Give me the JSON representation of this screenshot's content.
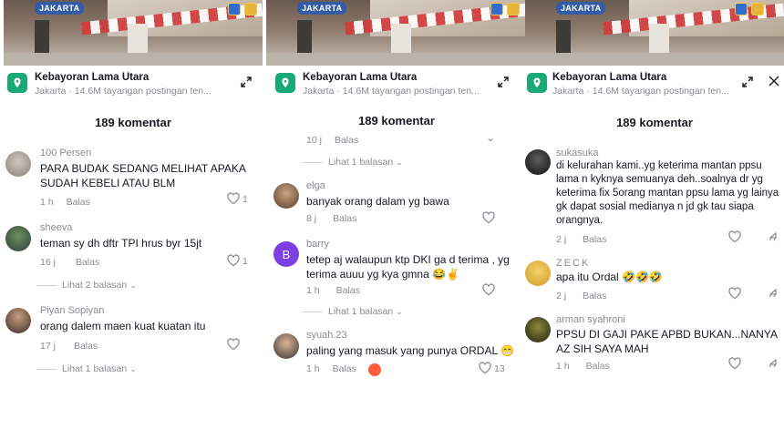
{
  "location": {
    "title": "Kebayoran Lama Utara",
    "subtitle": "Jakarta · 14.6M tayangan postingan ten...",
    "badge": "JAKARTA"
  },
  "comment_count": "189 komentar",
  "labels": {
    "reply": "Balas"
  },
  "panel1": {
    "comments": [
      {
        "user": "100 Persen",
        "text": "PARA BUDAK SEDANG MELIHAT APAKA SUDAH KEBELI ATAU BLM",
        "time": "1 h",
        "likes": "1"
      },
      {
        "user": "sheeva",
        "text": "teman sy dh dftr TPI hrus byr 15jt",
        "time": "16 j",
        "likes": "1",
        "more": "Lihat 2 balasan"
      },
      {
        "user": "Piyan Sopiyan",
        "text": "orang dalem maen kuat kuatan itu",
        "time": "17 j",
        "likes": "",
        "more": "Lihat 1 balasan"
      }
    ]
  },
  "panel2": {
    "top_meta": {
      "time": "10 j",
      "more": "Lihat 1 balasan"
    },
    "comments": [
      {
        "user": "elga",
        "text": "banyak orang dalam yg bawa",
        "time": "8 j",
        "likes": ""
      },
      {
        "user": "barry",
        "avatar_letter": "B",
        "text": "tetep aj walaupun ktp DKI ga d terima , yg terima auuu yg kya gmna 😂✌",
        "time": "1 h",
        "likes": "",
        "more": "Lihat 1 balasan"
      },
      {
        "user": "syuah.23",
        "text": "paling yang masuk yang punya ORDAL 😁",
        "time": "1 h",
        "likes": "13"
      }
    ]
  },
  "panel3": {
    "comments": [
      {
        "user": "sukasuka",
        "text": "di kelurahan kami..yg keterima mantan ppsu lama n kyknya semuanya deh..soalnya dr yg keterima fix 5orang mantan ppsu lama yg lainya gk dapat sosial medianya n jd gk tau siapa orangnya.",
        "time": "2 j",
        "likes": ""
      },
      {
        "user": "ZECK",
        "text": "apa itu Ordal 🤣🤣🤣",
        "time": "2 j",
        "likes": ""
      },
      {
        "user": "arman syahroni",
        "text": "PPSU DI GAJI PAKE APBD BUKAN...NANYA AZ SIH SAYA MAH",
        "time": "1 h",
        "likes": ""
      }
    ]
  },
  "icons": [
    "location-pin-icon",
    "expand-icon",
    "close-icon",
    "heart-icon",
    "share-icon",
    "chevron-down-icon"
  ],
  "colors": {
    "text": "#161823",
    "muted": "#8a8b91",
    "pin": "#19a974",
    "accent_purple": "#7b3fe4"
  }
}
